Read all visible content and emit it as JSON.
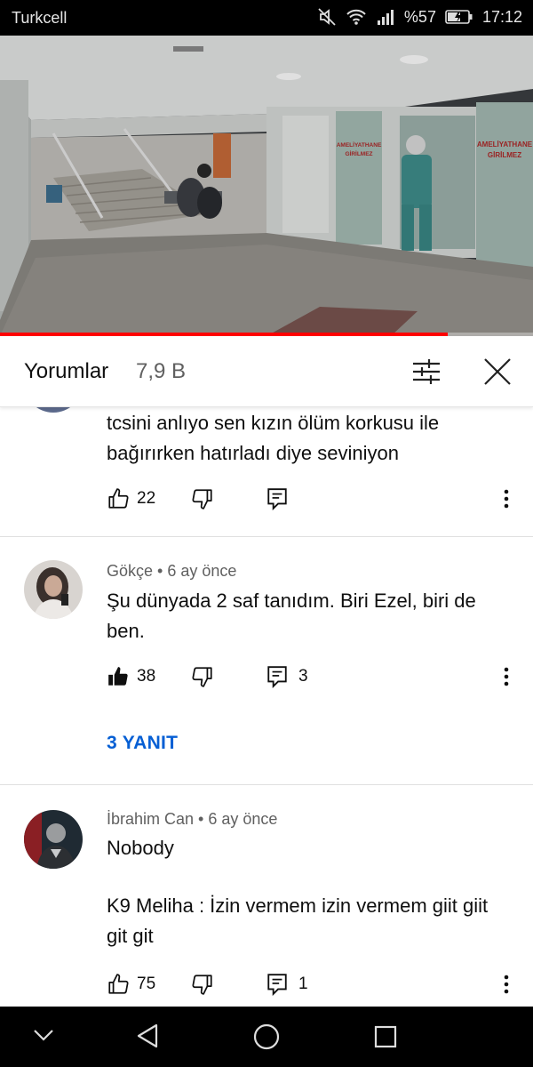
{
  "status_bar": {
    "carrier": "Turkcell",
    "battery_percent": "%57",
    "time": "17:12",
    "icons": [
      "mute-icon",
      "wifi-icon",
      "signal-icon",
      "battery-charging-icon"
    ]
  },
  "video": {
    "sign_left_line1": "AMELİYATHANE",
    "sign_left_line2": "GİRİLMEZ",
    "sign_right_line1": "AMELİYATHANE",
    "sign_right_line2": "GİRİLMEZ",
    "progress_fraction": 0.84
  },
  "comments_header": {
    "title": "Yorumlar",
    "count": "7,9 B",
    "filter_icon": "sort-sliders-icon",
    "close_icon": "close-icon"
  },
  "comments": [
    {
      "author": "",
      "time": "",
      "text": "tcsini anlıyo sen kızın ölüm korkusu ile bağırırken hatırladı diye seviniyon",
      "likes": "22",
      "replies_count": "",
      "liked": false
    },
    {
      "author": "Gökçe",
      "time": "6 ay önce",
      "text": "Şu dünyada 2 saf tanıdım. Biri Ezel, biri de ben.",
      "likes": "38",
      "replies_count": "3",
      "liked": true,
      "replies_link": "3 YANIT"
    },
    {
      "author": "İbrahim Can",
      "time": "6 ay önce",
      "text_line1": "Nobody",
      "text_line2": "K9 Meliha : İzin vermem izin vermem giit giit git git",
      "likes": "75",
      "replies_count": "1",
      "liked": false
    }
  ],
  "meta_separator": " • ",
  "nav_bar": {
    "icons": [
      "chevron-down-icon",
      "back-triangle-icon",
      "home-circle-icon",
      "recents-square-icon"
    ]
  },
  "colors": {
    "link_blue": "#065fd4",
    "progress_red": "#ff0000",
    "secondary_text": "#606060"
  }
}
